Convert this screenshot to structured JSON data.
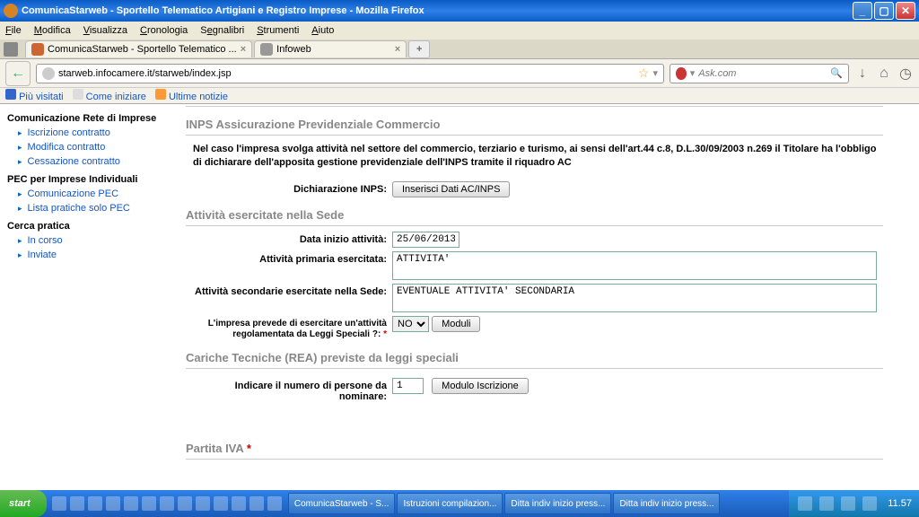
{
  "window": {
    "title": "ComunicaStarweb - Sportello Telematico Artigiani e Registro Imprese - Mozilla Firefox"
  },
  "menu": {
    "file": "File",
    "modifica": "Modifica",
    "visualizza": "Visualizza",
    "cronologia": "Cronologia",
    "segnalibri": "Segnalibri",
    "strumenti": "Strumenti",
    "aiuto": "Aiuto"
  },
  "tabs": {
    "tab1": "ComunicaStarweb - Sportello Telematico ...",
    "tab2": "Infoweb"
  },
  "url": "starweb.infocamere.it/starweb/index.jsp",
  "search": {
    "placeholder": "Ask.com"
  },
  "bookmarks": {
    "piu": "Più visitati",
    "come": "Come iniziare",
    "ultime": "Ultime notizie"
  },
  "sidebar": {
    "sec1": "Comunicazione Rete di Imprese",
    "s1a": "Iscrizione contratto",
    "s1b": "Modifica contratto",
    "s1c": "Cessazione contratto",
    "sec2": "PEC per Imprese Individuali",
    "s2a": "Comunicazione PEC",
    "s2b": "Lista pratiche solo PEC",
    "sec3": "Cerca pratica",
    "s3a": "In corso",
    "s3b": "Inviate"
  },
  "form": {
    "inps_title": "INPS Assicurazione Previdenziale Commercio",
    "inps_text": "Nel caso l'impresa svolga attività nel settore del commercio, terziario e turismo, ai sensi dell'art.44 c.8, D.L.30/09/2003 n.269 il Titolare ha l'obbligo di dichiarare dell'apposita gestione previdenziale dell'INPS tramite il riquadro AC",
    "dich_label": "Dichiarazione INPS:",
    "dich_btn": "Inserisci Dati AC/INPS",
    "att_title": "Attività esercitate nella Sede",
    "data_label": "Data inizio attività:",
    "data_val": "25/06/2013",
    "prim_label": "Attività primaria esercitata:",
    "prim_val": "ATTIVITA'",
    "sec_label": "Attività secondarie esercitate nella Sede:",
    "sec_val": "EVENTUALE ATTIVITA' SECONDARIA",
    "leggi_label": "L'impresa prevede di esercitare un'attività regolamentata da Leggi Speciali ?:",
    "leggi_val": "NO",
    "moduli_btn": "Moduli",
    "cariche_title": "Cariche Tecniche (REA) previste da leggi speciali",
    "persone_label": "Indicare il numero di persone da nominare:",
    "persone_val": "1",
    "modiscr_btn": "Modulo Iscrizione",
    "piva_title": "Partita IVA"
  },
  "taskbar": {
    "start": "start",
    "t1": "ComunicaStarweb - S...",
    "t2": "Istruzioni compilazion...",
    "t3": "Ditta indiv inizio press...",
    "t4": "Ditta indiv inizio press...",
    "clock": "11.57"
  }
}
